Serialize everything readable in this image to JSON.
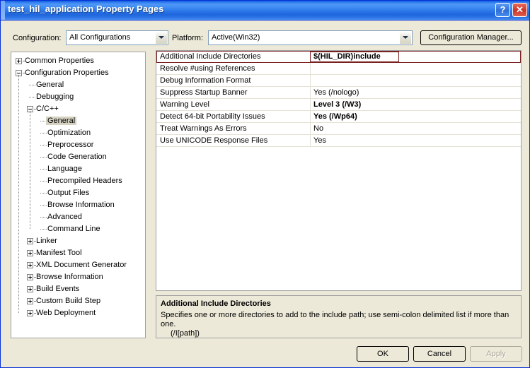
{
  "window": {
    "title": "test_hil_application Property Pages",
    "help_button": "?",
    "close_button": "✕"
  },
  "toolbar": {
    "configuration_label": "Configuration:",
    "configuration_value": "All Configurations",
    "platform_label": "Platform:",
    "platform_value": "Active(Win32)",
    "configuration_manager_label": "Configuration Manager..."
  },
  "tree": {
    "nodes": [
      {
        "label": "Common Properties",
        "depth": 0,
        "expander": "plus"
      },
      {
        "label": "Configuration Properties",
        "depth": 0,
        "expander": "minus"
      },
      {
        "label": "General",
        "depth": 1,
        "expander": "none"
      },
      {
        "label": "Debugging",
        "depth": 1,
        "expander": "none"
      },
      {
        "label": "C/C++",
        "depth": 1,
        "expander": "minus"
      },
      {
        "label": "General",
        "depth": 2,
        "expander": "none",
        "selected": true
      },
      {
        "label": "Optimization",
        "depth": 2,
        "expander": "none"
      },
      {
        "label": "Preprocessor",
        "depth": 2,
        "expander": "none"
      },
      {
        "label": "Code Generation",
        "depth": 2,
        "expander": "none"
      },
      {
        "label": "Language",
        "depth": 2,
        "expander": "none"
      },
      {
        "label": "Precompiled Headers",
        "depth": 2,
        "expander": "none"
      },
      {
        "label": "Output Files",
        "depth": 2,
        "expander": "none"
      },
      {
        "label": "Browse Information",
        "depth": 2,
        "expander": "none"
      },
      {
        "label": "Advanced",
        "depth": 2,
        "expander": "none"
      },
      {
        "label": "Command Line",
        "depth": 2,
        "expander": "none"
      },
      {
        "label": "Linker",
        "depth": 1,
        "expander": "plus"
      },
      {
        "label": "Manifest Tool",
        "depth": 1,
        "expander": "plus"
      },
      {
        "label": "XML Document Generator",
        "depth": 1,
        "expander": "plus"
      },
      {
        "label": "Browse Information",
        "depth": 1,
        "expander": "plus"
      },
      {
        "label": "Build Events",
        "depth": 1,
        "expander": "plus"
      },
      {
        "label": "Custom Build Step",
        "depth": 1,
        "expander": "plus"
      },
      {
        "label": "Web Deployment",
        "depth": 1,
        "expander": "plus"
      }
    ]
  },
  "property_grid": {
    "rows": [
      {
        "name": "Additional Include Directories",
        "value": "$(HIL_DIR)include",
        "bold": true,
        "selected": true
      },
      {
        "name": "Resolve #using References",
        "value": "",
        "bold": false,
        "selected": false
      },
      {
        "name": "Debug Information Format",
        "value": "",
        "bold": false,
        "selected": false
      },
      {
        "name": "Suppress Startup Banner",
        "value": "Yes (/nologo)",
        "bold": false,
        "selected": false
      },
      {
        "name": "Warning Level",
        "value": "Level 3 (/W3)",
        "bold": true,
        "selected": false
      },
      {
        "name": "Detect 64-bit Portability Issues",
        "value": "Yes (/Wp64)",
        "bold": true,
        "selected": false
      },
      {
        "name": "Treat Warnings As Errors",
        "value": "No",
        "bold": false,
        "selected": false
      },
      {
        "name": "Use UNICODE Response Files",
        "value": "Yes",
        "bold": false,
        "selected": false
      }
    ]
  },
  "description": {
    "title": "Additional Include Directories",
    "line1": "Specifies one or more directories to add to the include path; use semi-colon delimited list if more than one.",
    "line2": "(/I[path])"
  },
  "footer": {
    "ok_label": "OK",
    "cancel_label": "Cancel",
    "apply_label": "Apply",
    "apply_enabled": false
  },
  "colors": {
    "title_bar": "#2f7bef",
    "dialog_face": "#ece9d8",
    "selection_border": "#7b2020",
    "tree_selection": "#d6d2c2"
  }
}
